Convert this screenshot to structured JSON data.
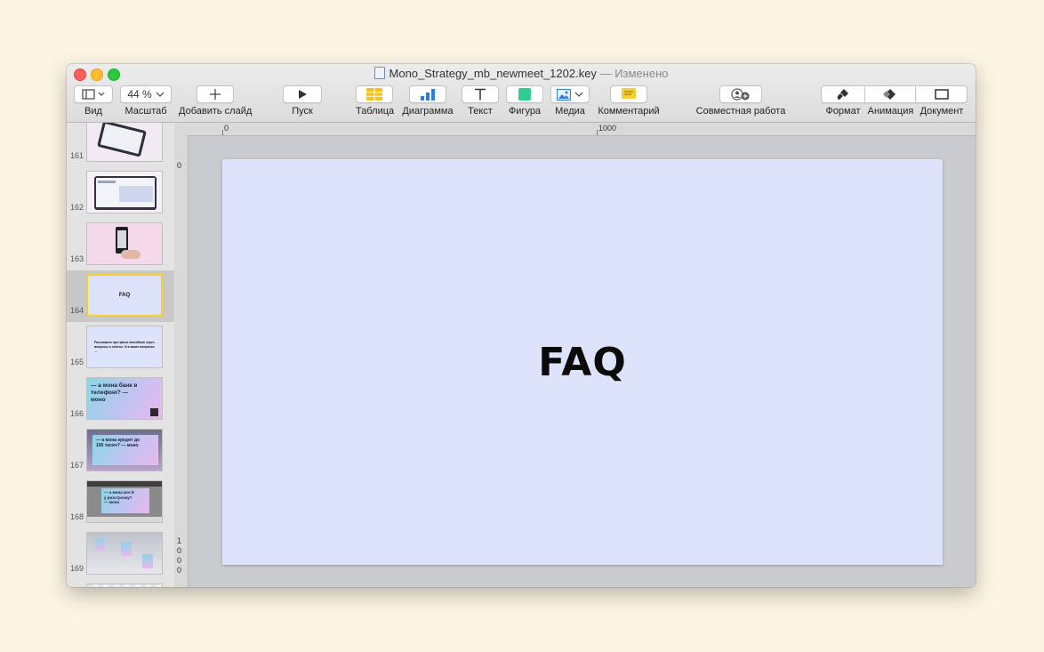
{
  "window": {
    "filename": "Mono_Strategy_mb_newmeet_1202.key",
    "status": "— Изменено"
  },
  "toolbar": {
    "view_label": "Вид",
    "zoom_value": "44 %",
    "zoom_label": "Масштаб",
    "add_slide_label": "Добавить слайд",
    "play_label": "Пуск",
    "table_label": "Таблица",
    "chart_label": "Диаграмма",
    "text_label": "Текст",
    "shape_label": "Фигура",
    "media_label": "Медиа",
    "comment_label": "Комментарий",
    "collab_label": "Совместная работа",
    "format_label": "Формат",
    "animate_label": "Анимация",
    "document_label": "Документ"
  },
  "rulers": {
    "top_start": "0",
    "top_1000": "1000",
    "left_start": "0",
    "left_1000": [
      "1",
      "0",
      "0",
      "0"
    ]
  },
  "sidebar": {
    "slides": [
      {
        "number": "161",
        "text": ""
      },
      {
        "number": "162",
        "text": ""
      },
      {
        "number": "163",
        "text": ""
      },
      {
        "number": "164",
        "text": "FAQ",
        "selected": true
      },
      {
        "number": "165",
        "text": "Расскажите про фичи monoBank через вопросы и ответы. И в каких вопросах ..."
      },
      {
        "number": "166",
        "text": "— а мона банк в телефоні? — моно"
      },
      {
        "number": "167",
        "text": "— а мона кредит до 100 тисяч? — моно"
      },
      {
        "number": "168",
        "text": "— а мона все й у розстрочку? — моно"
      },
      {
        "number": "169",
        "text": ""
      }
    ]
  },
  "slide": {
    "title": "FAQ",
    "background": "#dde3fb"
  },
  "colors": {
    "selection_border": "#f2d22a",
    "table_icon": "#f4c21c",
    "chart_icon": "#2a7fe0",
    "shape_icon": "#2ecc8e",
    "comment_icon": "#f6d033"
  }
}
